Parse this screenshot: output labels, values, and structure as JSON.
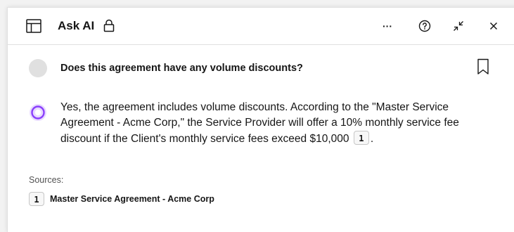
{
  "header": {
    "title": "Ask AI",
    "more_label": "···",
    "panel_icon": "panel-layout-icon",
    "lock_icon": "lock-icon",
    "help_icon": "help-icon",
    "minimize_icon": "minimize-icon",
    "close_icon": "close-icon"
  },
  "question": {
    "text": "Does this agreement have any volume discounts?",
    "avatar_icon": "user-avatar",
    "bookmark_icon": "bookmark-icon"
  },
  "answer": {
    "text": "Yes, the agreement includes volume discounts. According to the \"Master Service Agreement - Acme Corp,\" the Service Provider will offer a 10% monthly service fee discount if the Client's monthly service fees exceed $10,000",
    "citation": "1",
    "trailing": ".",
    "avatar_icon": "ai-assistant-icon",
    "accent_color": "#8a3ffc"
  },
  "sources": {
    "label": "Sources:",
    "items": [
      {
        "number": "1",
        "title": "Master Service Agreement - Acme Corp"
      }
    ]
  }
}
